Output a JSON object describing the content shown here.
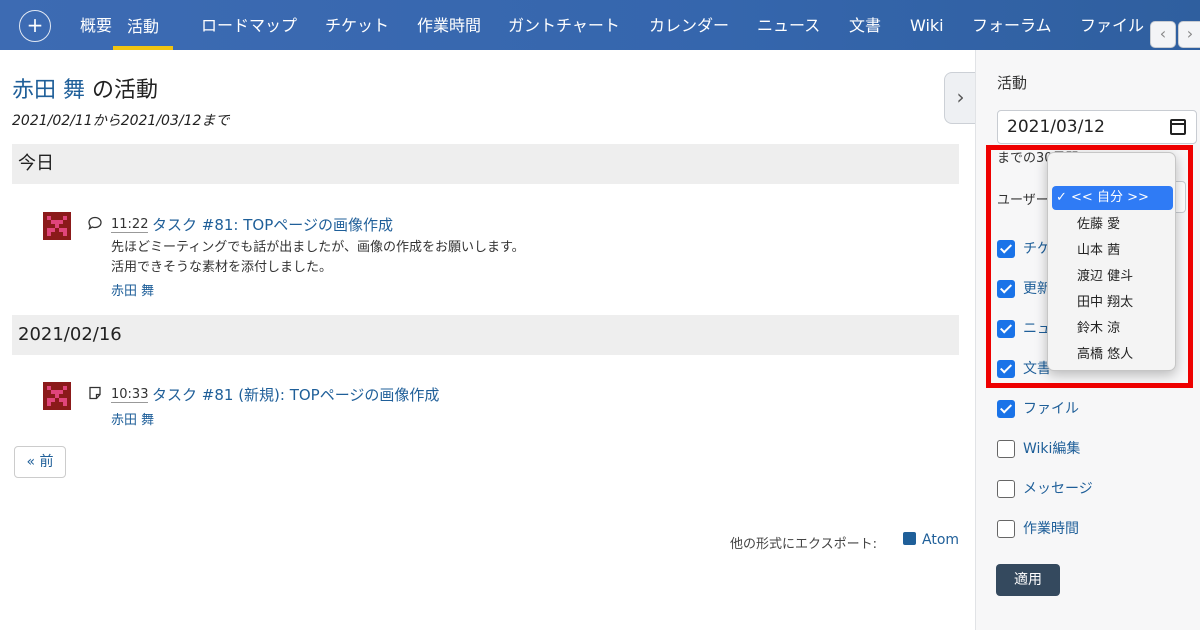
{
  "nav": {
    "plus": "+",
    "tabs": [
      "概要",
      "活動",
      "ロードマップ",
      "チケット",
      "作業時間",
      "ガントチャート",
      "カレンダー",
      "ニュース",
      "文書",
      "Wiki",
      "フォーラム",
      "ファイル"
    ],
    "active_tab": "活動",
    "scroll_left": "‹",
    "scroll_right": "›"
  },
  "main": {
    "user_name": "赤田 舞",
    "title_suffix": " の活動",
    "date_range": "2021/02/11から2021/03/12まで",
    "days": [
      {
        "header": "今日",
        "events": [
          {
            "icon": "comment-icon",
            "time": "11:22",
            "title": "タスク #81: TOPページの画像作成",
            "description": [
              "先ほどミーティングでも話が出ましたが、画像の作成をお願いします。",
              "活用できそうな素材を添付しました。"
            ],
            "author": "赤田 舞"
          }
        ]
      },
      {
        "header": "2021/02/16",
        "events": [
          {
            "icon": "note-icon",
            "time": "10:33",
            "title": "タスク #81 (新規): TOPページの画像作成",
            "author": "赤田 舞"
          }
        ]
      }
    ],
    "prev_button": "« 前",
    "export_label": "他の形式にエクスポート:",
    "atom_link": "Atom",
    "collapse_arrow": "›"
  },
  "sidebar": {
    "title": "活動",
    "date_value": "2021/03/12",
    "days_text": "までの30日間",
    "user_label": "ユーザー",
    "checkboxes": [
      {
        "label": "チケット",
        "checked": true
      },
      {
        "label": "更新履歴",
        "checked": true
      },
      {
        "label": "ニュース",
        "checked": true
      },
      {
        "label": "文書",
        "checked": true
      },
      {
        "label": "ファイル",
        "checked": true
      },
      {
        "label": "Wiki編集",
        "checked": false
      },
      {
        "label": "メッセージ",
        "checked": false
      },
      {
        "label": "作業時間",
        "checked": false
      }
    ],
    "apply_button": "適用",
    "user_dropdown": {
      "selected": "✓ << 自分 >>",
      "options": [
        "佐藤 愛",
        "山本 茜",
        "渡辺 健斗",
        "田中 翔太",
        "鈴木 涼",
        "高橋 悠人"
      ]
    }
  },
  "colors": {
    "nav_bg": "#3566ad",
    "link": "#1f5f99",
    "active_tab_underline": "#f1c40f",
    "checkbox_on": "#1a73e8",
    "apply_button": "#34495e",
    "dropdown_selected": "#2f7bf5",
    "highlight_box": "#ee0000"
  }
}
